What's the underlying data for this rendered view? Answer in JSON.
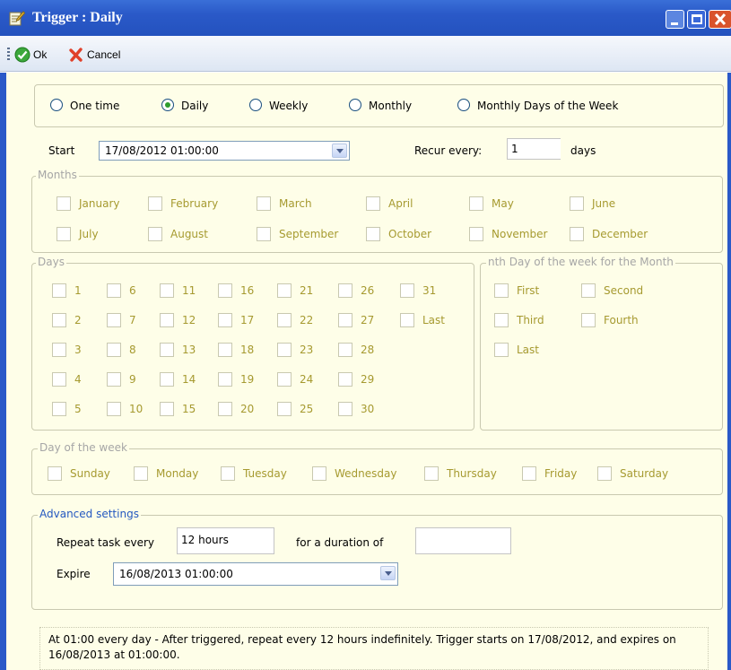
{
  "window": {
    "title": "Trigger : Daily",
    "icon": "document-edit-icon"
  },
  "toolbar": {
    "ok_label": "Ok",
    "cancel_label": "Cancel"
  },
  "schedule_type": {
    "selected": "Daily",
    "options": [
      "One time",
      "Daily",
      "Weekly",
      "Monthly",
      "Monthly Days of the Week"
    ]
  },
  "start": {
    "label": "Start",
    "value": "17/08/2012 01:00:00"
  },
  "recur": {
    "label": "Recur every:",
    "value": "1",
    "unit": "days"
  },
  "months": {
    "legend": "Months",
    "items": [
      "January",
      "February",
      "March",
      "April",
      "May",
      "June",
      "July",
      "August",
      "September",
      "October",
      "November",
      "December"
    ]
  },
  "days": {
    "legend": "Days",
    "items": [
      "1",
      "2",
      "3",
      "4",
      "5",
      "6",
      "7",
      "8",
      "9",
      "10",
      "11",
      "12",
      "13",
      "14",
      "15",
      "16",
      "17",
      "18",
      "19",
      "20",
      "21",
      "22",
      "23",
      "24",
      "25",
      "26",
      "27",
      "28",
      "29",
      "30",
      "31",
      "Last"
    ]
  },
  "nth_day": {
    "legend": "nth Day of the week for the Month",
    "items": [
      "First",
      "Second",
      "Third",
      "Fourth",
      "Last"
    ]
  },
  "day_of_week": {
    "legend": "Day of the week",
    "items": [
      "Sunday",
      "Monday",
      "Tuesday",
      "Wednesday",
      "Thursday",
      "Friday",
      "Saturday"
    ]
  },
  "advanced": {
    "legend": "Advanced settings",
    "repeat_label": "Repeat task every",
    "repeat_value": "12 hours",
    "duration_label": "for a duration of",
    "duration_value": "",
    "expire_label": "Expire",
    "expire_value": "16/08/2013 01:00:00"
  },
  "summary": "At 01:00 every day - After triggered, repeat every 12 hours indefinitely. Trigger starts on 17/08/2012, and expires on 16/08/2013 at 01:00:00.",
  "colors": {
    "titlebar": "#2a59c8",
    "panel_bg": "#fefee8",
    "disabled_text": "#a69a30",
    "legend_gray": "#a6a6a6",
    "legend_blue": "#2458c0",
    "radio_dot": "#2d9c2d"
  }
}
